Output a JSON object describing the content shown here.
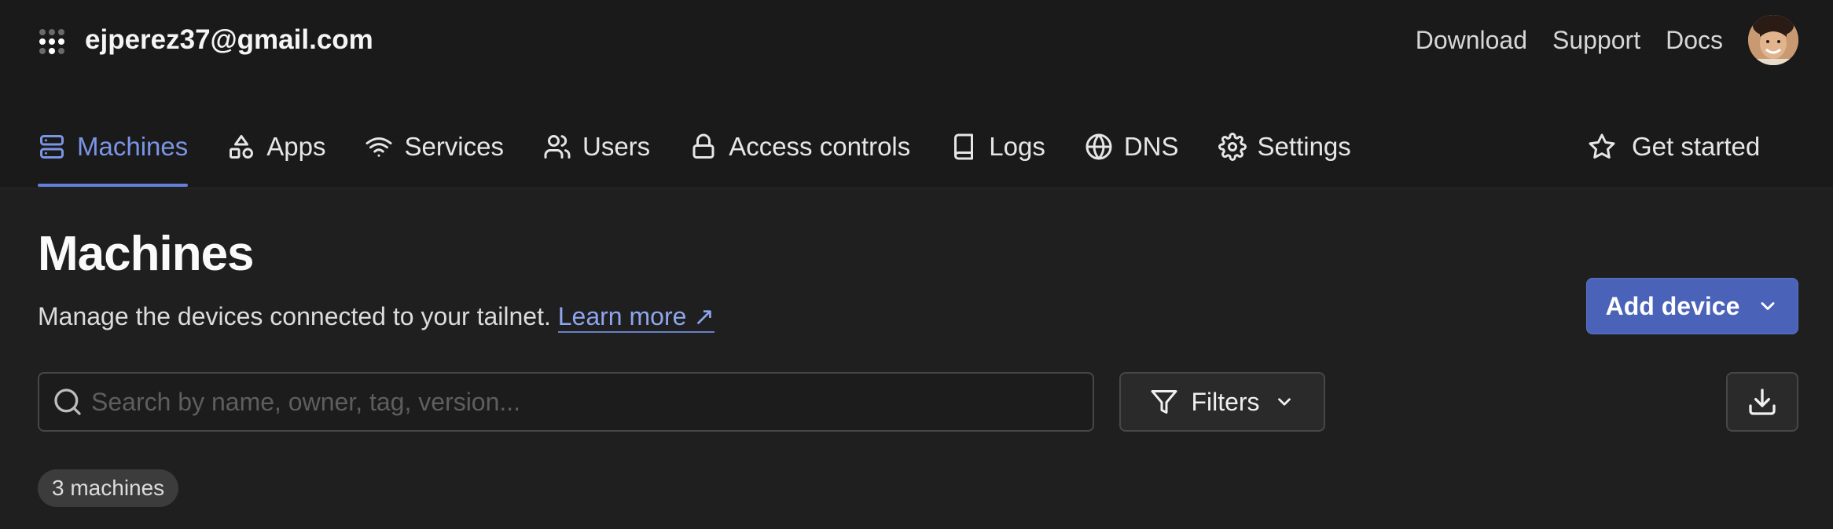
{
  "header": {
    "account_email": "ejperez37@gmail.com",
    "links": [
      "Download",
      "Support",
      "Docs"
    ]
  },
  "nav": {
    "items": [
      {
        "label": "Machines",
        "icon": "server-icon",
        "active": true
      },
      {
        "label": "Apps",
        "icon": "shapes-icon",
        "active": false
      },
      {
        "label": "Services",
        "icon": "wifi-icon",
        "active": false
      },
      {
        "label": "Users",
        "icon": "users-icon",
        "active": false
      },
      {
        "label": "Access controls",
        "icon": "lock-icon",
        "active": false
      },
      {
        "label": "Logs",
        "icon": "book-icon",
        "active": false
      },
      {
        "label": "DNS",
        "icon": "globe-icon",
        "active": false
      },
      {
        "label": "Settings",
        "icon": "gear-icon",
        "active": false
      }
    ],
    "get_started": "Get started"
  },
  "page": {
    "title": "Machines",
    "description": "Manage the devices connected to your tailnet.",
    "learn_more": "Learn more ↗",
    "add_device": "Add device"
  },
  "toolbar": {
    "search_placeholder": "Search by name, owner, tag, version...",
    "filters_label": "Filters"
  },
  "summary": {
    "count_label": "3 machines"
  },
  "colors": {
    "accent": "#7b95e6",
    "primary_button": "#4a63b8",
    "background": "#1f1f1f",
    "header_background": "#1a1a1a"
  }
}
